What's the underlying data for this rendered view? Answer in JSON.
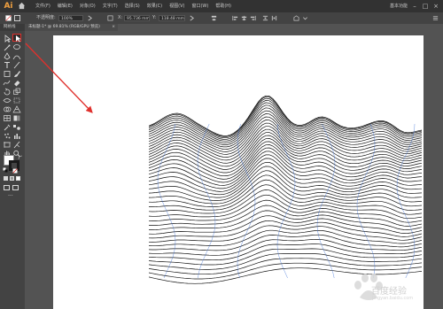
{
  "app": {
    "logo": "Ai",
    "workspace": "基本功能"
  },
  "menu": [
    "文件(F)",
    "编辑(E)",
    "对象(O)",
    "文字(T)",
    "选择(S)",
    "效果(C)",
    "视图(V)",
    "窗口(W)",
    "帮助(H)"
  ],
  "controls": {
    "opacity_label": "不透明度:",
    "opacity_value": "100%",
    "x_label": "X:",
    "x_value": "95.736 mm",
    "y_label": "Y:",
    "y_value": "118.48 mm"
  },
  "panel_tab": "网格线",
  "document_tab": "未标题-1* @ 69.81% (RGB/GPU 预览)",
  "watermark": {
    "text": "百度经验",
    "url": "jingyan.baidu.com"
  },
  "colors": {
    "accent": "#e0302c",
    "chrome_dark": "#323232",
    "chrome_mid": "#434343",
    "canvas": "#535353"
  }
}
